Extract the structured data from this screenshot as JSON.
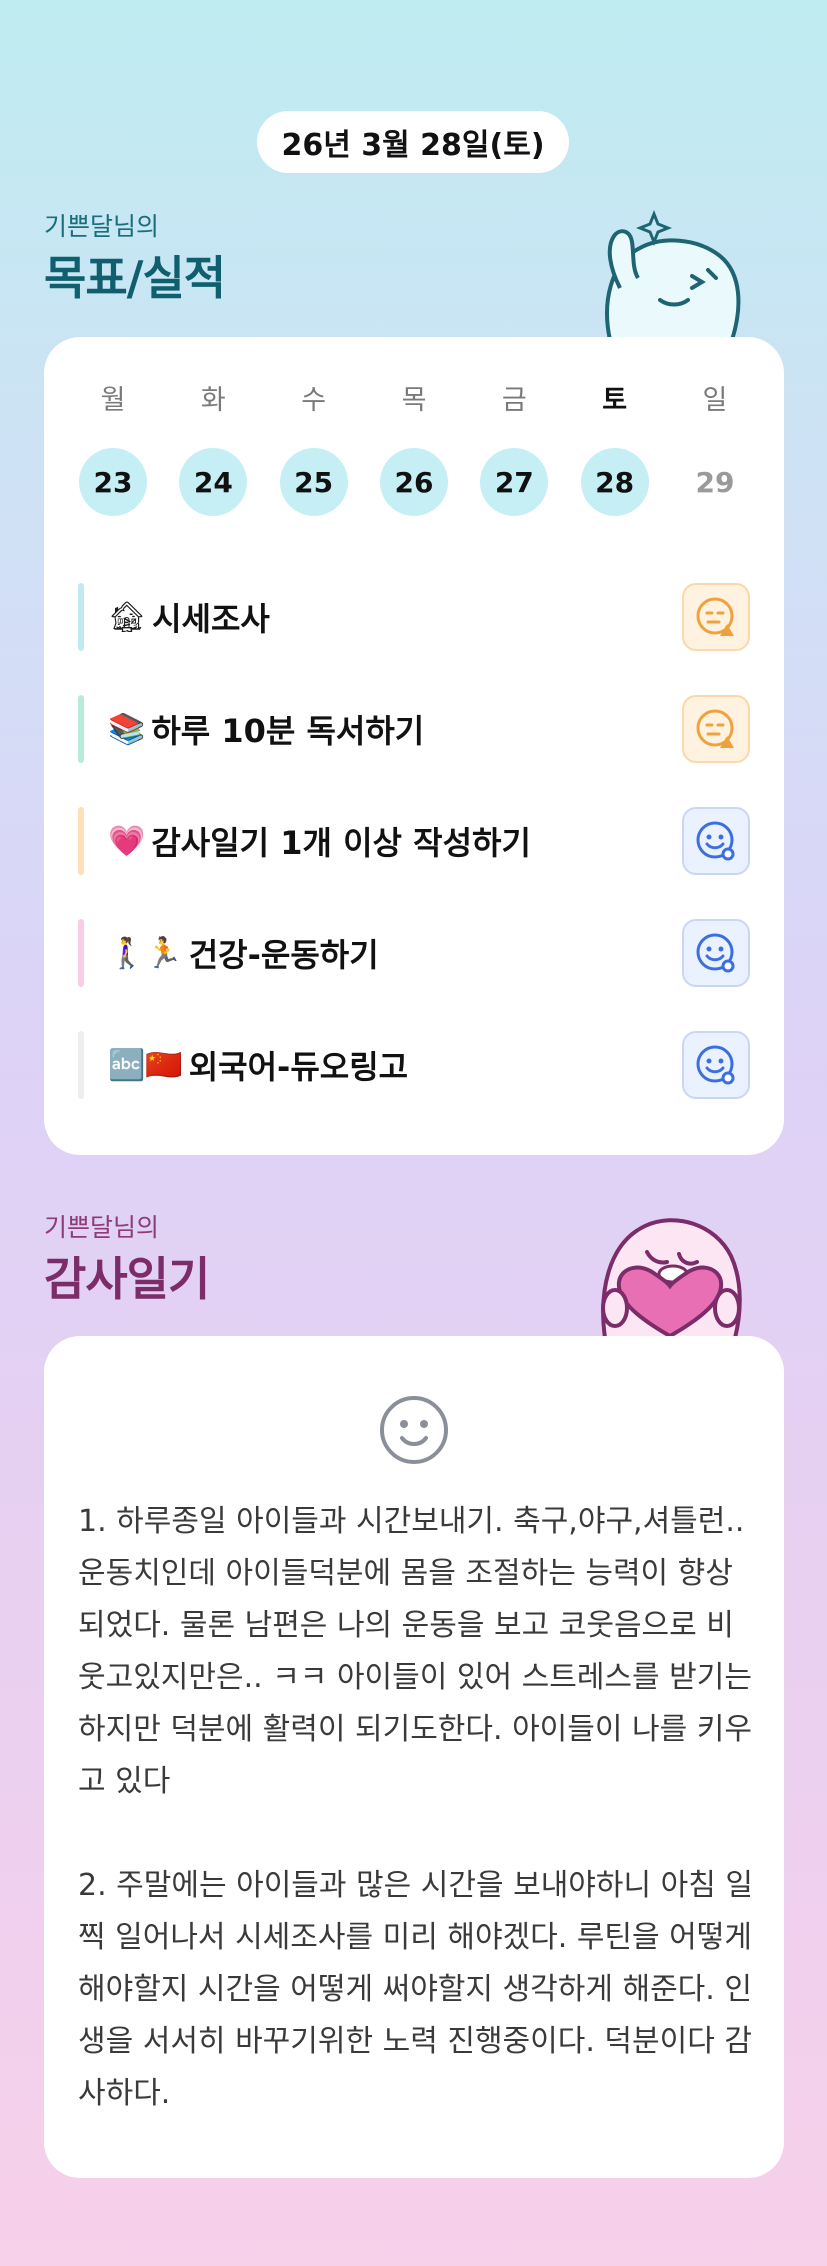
{
  "header": {
    "date_label": "26년 3월 28일(토)"
  },
  "goals_section": {
    "subtitle": "기쁜달님의",
    "title": "목표/실적",
    "week": [
      {
        "dow": "월",
        "day": "23",
        "done": true,
        "today": false
      },
      {
        "dow": "화",
        "day": "24",
        "done": true,
        "today": false
      },
      {
        "dow": "수",
        "day": "25",
        "done": true,
        "today": false
      },
      {
        "dow": "목",
        "day": "26",
        "done": true,
        "today": false
      },
      {
        "dow": "금",
        "day": "27",
        "done": true,
        "today": false
      },
      {
        "dow": "토",
        "day": "28",
        "done": true,
        "today": true
      },
      {
        "dow": "일",
        "day": "29",
        "done": false,
        "today": false
      }
    ],
    "items": [
      {
        "emoji": "🏚",
        "label": "시세조사",
        "bar_color": "#bfeaf0",
        "status": "warning",
        "status_icon": "face-warning-icon"
      },
      {
        "emoji": "📚",
        "label": "하루 10분 독서하기",
        "bar_color": "#b8ecd8",
        "status": "warning",
        "status_icon": "face-warning-icon"
      },
      {
        "emoji": "💗",
        "label": "감사일기 1개 이상 작성하기",
        "bar_color": "#fde0b8",
        "status": "ok",
        "status_icon": "face-ok-icon"
      },
      {
        "emoji": "🚶‍♀️🏃",
        "label": "건강-운동하기",
        "bar_color": "#f9cde6",
        "status": "ok",
        "status_icon": "face-ok-icon"
      },
      {
        "emoji": "🔤🇨🇳",
        "label": "외국어-듀오링고",
        "bar_color": "#eeeeee",
        "status": "ok",
        "status_icon": "face-ok-icon"
      }
    ]
  },
  "thanks_section": {
    "subtitle": "기쁜달님의",
    "title": "감사일기",
    "mood_icon": "smile-face-icon",
    "entries": [
      "1. 하루종일 아이들과 시간보내기. 축구,야구,셔틀런.. 운동치인데 아이들덕분에 몸을 조절하는 능력이 향상되었다. 물론 남편은 나의 운동을 보고 코웃음으로 비웃고있지만은.. ㅋㅋ 아이들이 있어 스트레스를 받기는 하지만 덕분에 활력이 되기도한다. 아이들이 나를 키우고 있다",
      "2. 주말에는 아이들과 많은 시간을 보내야하니 아침 일찍 일어나서 시세조사를 미리 해야겠다. 루틴을 어떻게 해야할지 시간을 어떻게 써야할지 생각하게 해준다. 인생을 서서히 바꾸기위한 노력 진행중이다. 덕분이다 감사하다."
    ]
  },
  "colors": {
    "done_circle": "#c5eff5",
    "goal_title": "#0f5f6e",
    "thanks_title": "#7c2c68",
    "warning": "#f0a23a",
    "ok": "#3d6ee0"
  }
}
